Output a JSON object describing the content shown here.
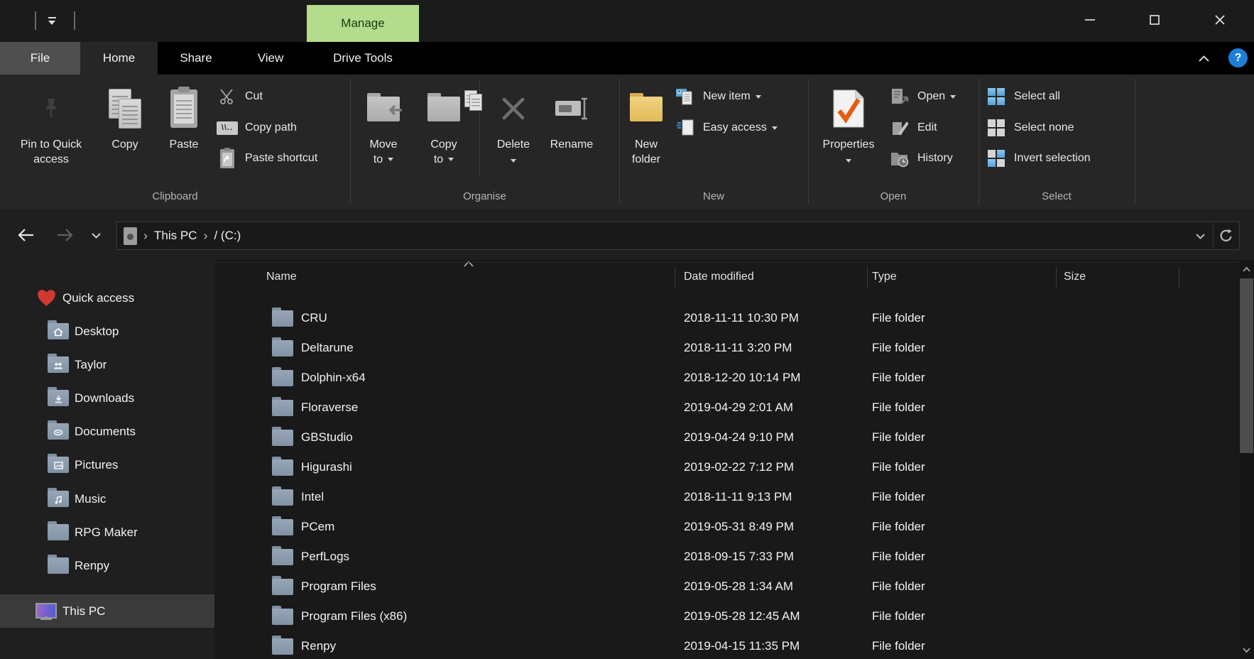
{
  "titlebar": {
    "contextual_tab": "Manage"
  },
  "tabs": {
    "file": "File",
    "home": "Home",
    "share": "Share",
    "view": "View",
    "drive_tools": "Drive Tools",
    "active": "Home"
  },
  "ribbon": {
    "clipboard": {
      "label": "Clipboard",
      "pin_line1": "Pin to Quick",
      "pin_line2": "access",
      "copy": "Copy",
      "paste": "Paste",
      "cut": "Cut",
      "copy_path": "Copy path",
      "paste_shortcut": "Paste shortcut"
    },
    "organise": {
      "label": "Organise",
      "move_line1": "Move",
      "move_line2": "to",
      "copyto_line1": "Copy",
      "copyto_line2": "to",
      "delete": "Delete",
      "rename": "Rename"
    },
    "new": {
      "label": "New",
      "folder_line1": "New",
      "folder_line2": "folder",
      "new_item": "New item",
      "easy_access": "Easy access"
    },
    "open": {
      "label": "Open",
      "properties": "Properties",
      "open": "Open",
      "edit": "Edit",
      "history": "History"
    },
    "select": {
      "label": "Select",
      "select_all": "Select all",
      "select_none": "Select none",
      "invert": "Invert selection"
    }
  },
  "address_bar": {
    "crumb_root": "This PC",
    "crumb_drive": "/ (C:)"
  },
  "sidebar": {
    "items": [
      {
        "label": "Quick access",
        "icon": "heart"
      },
      {
        "label": "Desktop",
        "icon": "folder-desktop"
      },
      {
        "label": "Taylor",
        "icon": "folder-user"
      },
      {
        "label": "Downloads",
        "icon": "folder-downloads"
      },
      {
        "label": "Documents",
        "icon": "folder-documents"
      },
      {
        "label": "Pictures",
        "icon": "folder-pictures"
      },
      {
        "label": "Music",
        "icon": "folder-music"
      },
      {
        "label": "RPG Maker",
        "icon": "folder"
      },
      {
        "label": "Renpy",
        "icon": "folder"
      },
      {
        "label": "This PC",
        "icon": "this-pc",
        "selected": true
      }
    ]
  },
  "file_list": {
    "columns": [
      "Name",
      "Date modified",
      "Type",
      "Size"
    ],
    "sort": {
      "column": "Name",
      "direction": "ascending"
    },
    "rows": [
      {
        "name": "CRU",
        "date_modified": "2018-11-11 10:30 PM",
        "type": "File folder",
        "size": ""
      },
      {
        "name": "Deltarune",
        "date_modified": "2018-11-11 3:20 PM",
        "type": "File folder",
        "size": ""
      },
      {
        "name": "Dolphin-x64",
        "date_modified": "2018-12-20 10:14 PM",
        "type": "File folder",
        "size": ""
      },
      {
        "name": "Floraverse",
        "date_modified": "2019-04-29 2:01 AM",
        "type": "File folder",
        "size": ""
      },
      {
        "name": "GBStudio",
        "date_modified": "2019-04-24 9:10 PM",
        "type": "File folder",
        "size": ""
      },
      {
        "name": "Higurashi",
        "date_modified": "2019-02-22 7:12 PM",
        "type": "File folder",
        "size": ""
      },
      {
        "name": "Intel",
        "date_modified": "2018-11-11 9:13 PM",
        "type": "File folder",
        "size": ""
      },
      {
        "name": "PCem",
        "date_modified": "2019-05-31 8:49 PM",
        "type": "File folder",
        "size": ""
      },
      {
        "name": "PerfLogs",
        "date_modified": "2018-09-15 7:33 PM",
        "type": "File folder",
        "size": ""
      },
      {
        "name": "Program Files",
        "date_modified": "2019-05-28 1:34 AM",
        "type": "File folder",
        "size": ""
      },
      {
        "name": "Program Files (x86)",
        "date_modified": "2019-05-28 12:45 AM",
        "type": "File folder",
        "size": ""
      },
      {
        "name": "Renpy",
        "date_modified": "2019-04-15 11:35 PM",
        "type": "File folder",
        "size": ""
      }
    ]
  },
  "colors": {
    "manage_green": "#b3dd8d",
    "ribbon_bg": "#262626",
    "selection_gray": "#3a3a3a",
    "folder_slate": "#8898ab",
    "folder_yellow": "#e9c76d",
    "heart_red": "#cf3932",
    "help_blue": "#1c80d8",
    "select_blue": "#6fb1e2",
    "check_orange": "#e75c12"
  }
}
